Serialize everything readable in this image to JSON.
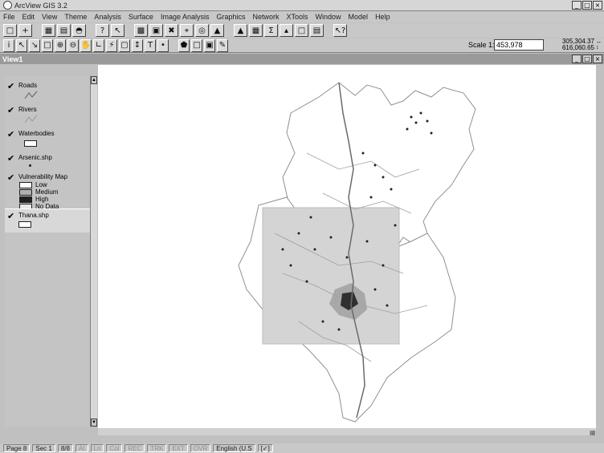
{
  "app": {
    "title": "ArcView GIS 3.2",
    "window_buttons": [
      "_",
      "□",
      "×"
    ]
  },
  "menu": [
    "File",
    "Edit",
    "View",
    "Theme",
    "Analysis",
    "Surface",
    "Image Analysis",
    "Graphics",
    "Network",
    "XTools",
    "Window",
    "Model",
    "Help"
  ],
  "toolbar1": [
    "save-icon",
    "add-theme-icon",
    "table-icon",
    "print-icon",
    "find-icon",
    "help-icon",
    "pointer-icon",
    "export-icon",
    "layout-icon",
    "zoom-full-icon",
    "zoom-extent-icon",
    "zoom-active-icon",
    "zoom-prev-icon",
    "chart-icon",
    "stats-icon",
    "sum-icon",
    "graph-icon",
    "hotlink-icon",
    "query-icon",
    "whats-this-icon"
  ],
  "toolbar2": [
    "identify-icon",
    "select-icon",
    "vertex-icon",
    "select-feature-icon",
    "zoom-in-icon",
    "zoom-out-icon",
    "pan-icon",
    "measure-icon",
    "hotlink-tool-icon",
    "area-icon",
    "line-icon",
    "text-icon",
    "point-icon",
    "polygon-icon",
    "snap-icon",
    "label-icon",
    "draw-icon"
  ],
  "scale": {
    "label": "Scale 1:",
    "value": "453,978"
  },
  "coords": {
    "x": "305,304.37",
    "y": "616,060.65"
  },
  "view": {
    "title": "View1"
  },
  "toc": {
    "themes": [
      {
        "name": "Roads",
        "legend": "line-gray"
      },
      {
        "name": "Rivers",
        "legend": "line-light"
      },
      {
        "name": "Waterbodies",
        "legend": "box"
      },
      {
        "name": "Arsenic.shp",
        "legend": "dot"
      },
      {
        "name": "Vulnerability Map",
        "classes": [
          "Low",
          "Medium",
          "High",
          "No Data"
        ]
      },
      {
        "name": "Thana.shp",
        "legend": "box"
      }
    ]
  },
  "status": {
    "page": "Page 8",
    "sec": "Sec 1",
    "count": "8/8",
    "at": "At",
    "ln": "Ln",
    "col": "Col",
    "rec": "REC",
    "trk": "TRK",
    "ext": "EXT",
    "ovr": "OVR",
    "lang": "English (U.S",
    "extra": "[✓]"
  },
  "colors": {
    "low": "#ffffff",
    "medium": "#b0b0b0",
    "high": "#202020",
    "nodata": "#e8e8e8",
    "map_fill": "#d8d8d8"
  }
}
